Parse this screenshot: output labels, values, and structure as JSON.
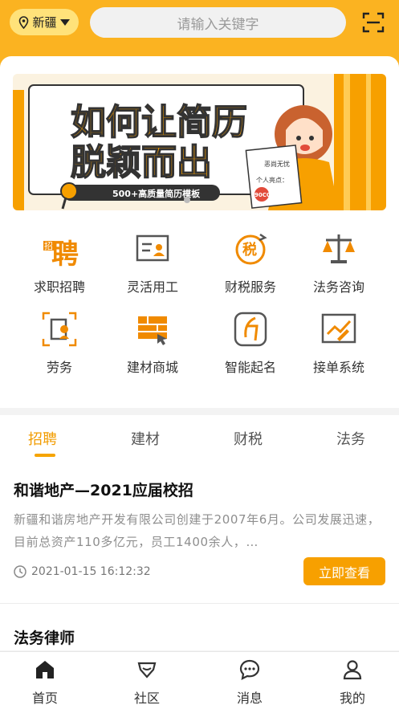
{
  "header": {
    "location": "新疆",
    "search_placeholder": "请输入关键字"
  },
  "banner": {
    "title_line1": "如何让简历",
    "title_line2": "脱颖而出",
    "tag": "500+高质量简历模板",
    "doc_label1": "恶尚无忧",
    "doc_label2": "个人亮点：",
    "stamp": "90CO"
  },
  "services": [
    {
      "label": "求职招聘",
      "icon": "recruit-icon"
    },
    {
      "label": "灵活用工",
      "icon": "flex-work-icon"
    },
    {
      "label": "财税服务",
      "icon": "tax-icon"
    },
    {
      "label": "法务咨询",
      "icon": "law-scale-icon"
    },
    {
      "label": "劳务",
      "icon": "labor-icon"
    },
    {
      "label": "建材商城",
      "icon": "building-store-icon"
    },
    {
      "label": "智能起名",
      "icon": "naming-icon"
    },
    {
      "label": "接单系统",
      "icon": "order-system-icon"
    }
  ],
  "recruit_badge": "招",
  "recruit_char": "聘",
  "tax_char": "税",
  "tabs": [
    "招聘",
    "建材",
    "财税",
    "法务"
  ],
  "active_tab": "招聘",
  "jobs": [
    {
      "title": "和谐地产—2021应届校招",
      "desc": "新疆和谐房地产开发有限公司创建于2007年6月。公司发展迅速，目前总资产110多亿元，员工1400余人，…",
      "time": "2021-01-15 16:12:32",
      "action": "立即查看"
    },
    {
      "title": "法务律师"
    }
  ],
  "bottom_nav": [
    {
      "label": "首页",
      "icon": "home-icon"
    },
    {
      "label": "社区",
      "icon": "community-icon"
    },
    {
      "label": "消息",
      "icon": "message-icon"
    },
    {
      "label": "我的",
      "icon": "profile-icon"
    }
  ],
  "colors": {
    "accent": "#f7a000",
    "header_bg": "#fbb321",
    "icon_orange": "#f08a00"
  }
}
